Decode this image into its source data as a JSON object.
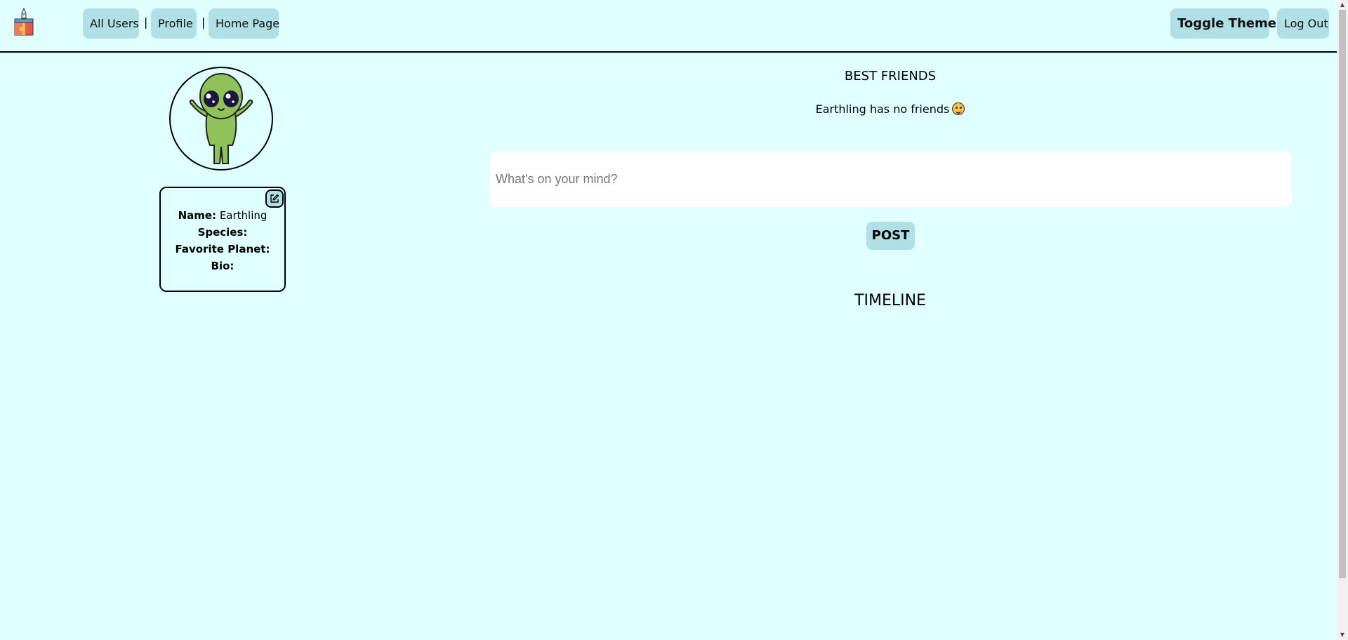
{
  "nav": {
    "all_users": "All Users",
    "profile": "Profile",
    "home_page": "Home Page",
    "separator": "|",
    "toggle_theme": "Toggle Theme",
    "log_out": "Log Out"
  },
  "profile_card": {
    "name_label": "Name:",
    "name_value": "Earthling",
    "species_label": "Species:",
    "species_value": "",
    "planet_label": "Favorite Planet:",
    "planet_value": "",
    "bio_label": "Bio:",
    "bio_value": ""
  },
  "best_friends": {
    "title": "BEST FRIENDS",
    "empty_text": "Earthling has no friends"
  },
  "composer": {
    "placeholder": "What's on your mind?",
    "post_label": "POST"
  },
  "timeline": {
    "title": "TIMELINE"
  },
  "colors": {
    "background": "#e0ffff",
    "button": "#b0dfe5"
  },
  "icons": {
    "logo": "rocket-gift-logo-icon",
    "edit": "edit-icon",
    "emoji": "laughing-emoji-icon"
  }
}
